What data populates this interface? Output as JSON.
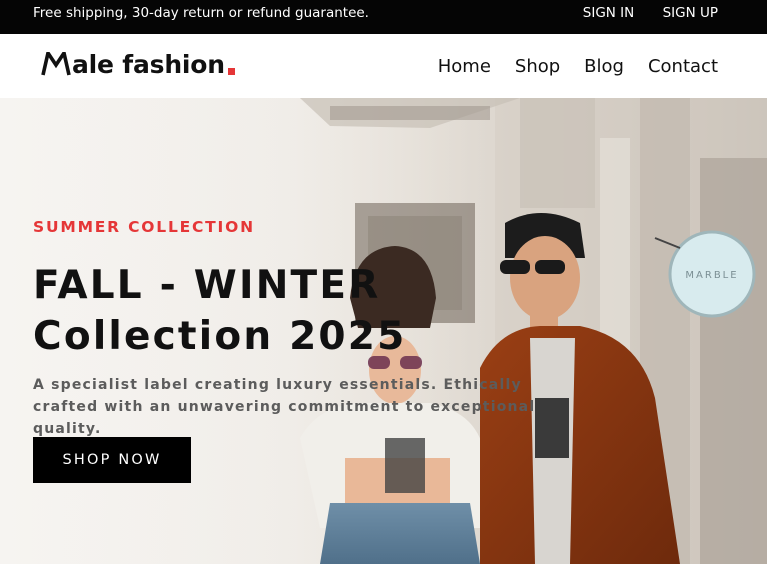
{
  "topbar": {
    "note": "Free shipping, 30-day return or refund guarantee.",
    "sign_in": "SIGN IN",
    "sign_up": "SIGN UP"
  },
  "header": {
    "logo_text": "ale fashion",
    "logo_mark": "M",
    "logo_accent_color": "#e53637",
    "nav": [
      "Home",
      "Shop",
      "Blog",
      "Contact"
    ]
  },
  "hero": {
    "eyebrow": "SUMMER COLLECTION",
    "title_line1": "FALL - WINTER",
    "title_line2": "Collection 2025",
    "description": "A specialist label creating luxury essentials. Ethically crafted with an unwavering commitment to exceptional quality.",
    "cta": "SHOP NOW",
    "sign_text": "MARBLE"
  },
  "colors": {
    "accent": "#e53637",
    "topbar_bg": "#050505",
    "cta_bg": "#000000"
  }
}
